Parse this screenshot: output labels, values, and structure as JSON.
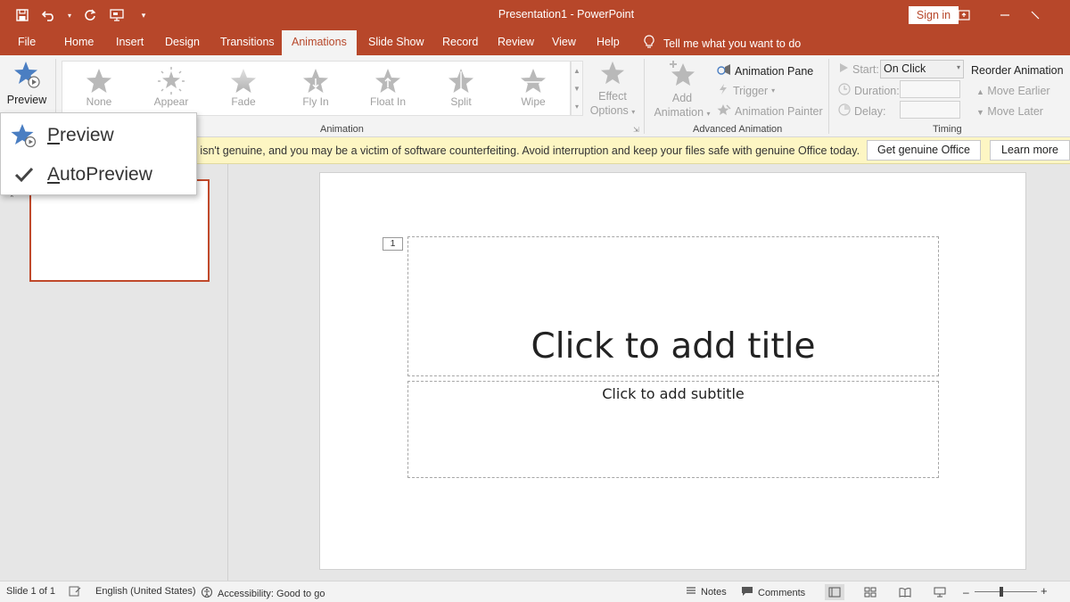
{
  "window": {
    "title": "Presentation1 - PowerPoint",
    "sign_in": "Sign in"
  },
  "tabs": [
    "File",
    "Home",
    "Insert",
    "Design",
    "Transitions",
    "Animations",
    "Slide Show",
    "Record",
    "Review",
    "View",
    "Help"
  ],
  "active_tab": "Animations",
  "tell_me": "Tell me what you want to do",
  "ribbon": {
    "preview_label": "Preview",
    "gallery": [
      "None",
      "Appear",
      "Fade",
      "Fly In",
      "Float In",
      "Split",
      "Wipe"
    ],
    "effect_options_l1": "Effect",
    "effect_options_l2": "Options",
    "animation_group": "Animation",
    "add_animation_l1": "Add",
    "add_animation_l2": "Animation",
    "animation_pane": "Animation Pane",
    "trigger": "Trigger",
    "animation_painter": "Animation Painter",
    "advanced_group": "Advanced Animation",
    "start_label": "Start:",
    "start_value": "On Click",
    "duration_label": "Duration:",
    "delay_label": "Delay:",
    "reorder_title": "Reorder Animation",
    "move_earlier": "Move Earlier",
    "move_later": "Move Later",
    "timing_group": "Timing"
  },
  "message_bar": {
    "text": "e isn't genuine, and you may be a victim of software counterfeiting. Avoid interruption and keep your files safe with genuine Office today.",
    "get_genuine": "Get genuine Office",
    "learn_more": "Learn more"
  },
  "dropdown": {
    "preview_first": "P",
    "preview_rest": "review",
    "autopreview_first": "A",
    "autopreview_rest": "utoPreview"
  },
  "thumbnail": {
    "marker": "*"
  },
  "slide": {
    "anim_tag": "1",
    "title_placeholder": "Click to add title",
    "subtitle_placeholder": "Click to add subtitle"
  },
  "status": {
    "slide": "Slide 1 of 1",
    "language": "English (United States)",
    "accessibility": "Accessibility: Good to go",
    "notes": "Notes",
    "comments": "Comments",
    "zoom_minus": "–",
    "zoom_plus": "+"
  },
  "colors": {
    "brand": "#b7472a",
    "accent_star": "#4a7ec2",
    "message_bar": "#fdf6c3"
  }
}
